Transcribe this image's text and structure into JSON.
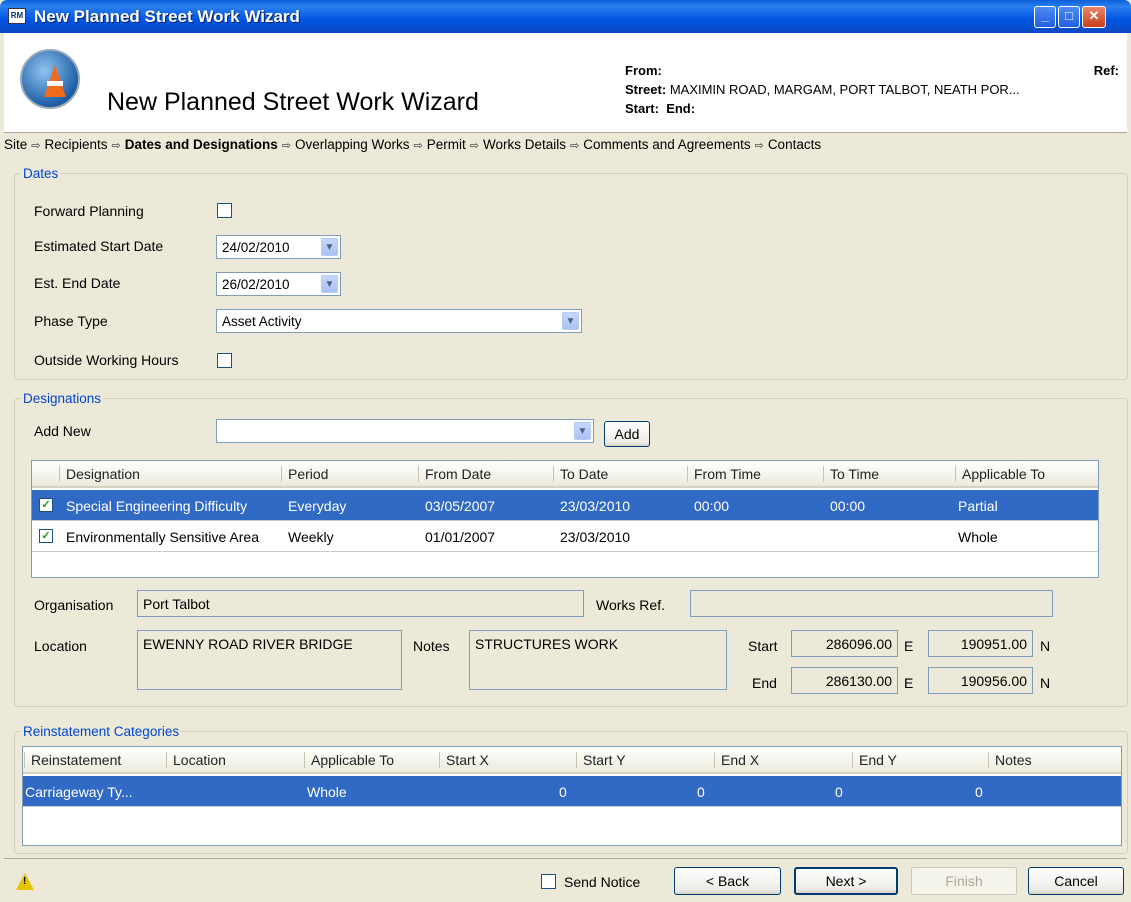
{
  "window": {
    "title": "New Planned Street Work Wizard",
    "app_icon_text": "RM"
  },
  "header": {
    "title": "New Planned Street Work Wizard",
    "from_label": "From:",
    "ref_label": "Ref:",
    "street_label": "Street:",
    "street_value": "MAXIMIN ROAD, MARGAM, PORT TALBOT, NEATH POR...",
    "start_label": "Start:",
    "end_label": "End:"
  },
  "steps": [
    {
      "label": "Site"
    },
    {
      "label": "Recipients"
    },
    {
      "label": "Dates and Designations",
      "active": true
    },
    {
      "label": "Overlapping Works"
    },
    {
      "label": "Permit"
    },
    {
      "label": "Works Details"
    },
    {
      "label": "Comments and Agreements"
    },
    {
      "label": "Contacts"
    }
  ],
  "dates": {
    "legend": "Dates",
    "forward_planning_label": "Forward Planning",
    "forward_planning_checked": false,
    "est_start_label": "Estimated Start Date",
    "est_start_value": "24/02/2010",
    "est_end_label": "Est. End Date",
    "est_end_value": "26/02/2010",
    "phase_type_label": "Phase Type",
    "phase_type_value": "Asset Activity",
    "outside_hours_label": "Outside Working Hours",
    "outside_hours_checked": false
  },
  "designations": {
    "legend": "Designations",
    "add_new_label": "Add New",
    "add_new_value": "",
    "add_button": "Add",
    "columns": [
      "Designation",
      "Period",
      "From Date",
      "To Date",
      "From Time",
      "To Time",
      "Applicable To"
    ],
    "rows": [
      {
        "checked": true,
        "selected": true,
        "cells": [
          "Special Engineering Difficulty",
          "Everyday",
          "03/05/2007",
          "23/03/2010",
          "00:00",
          "00:00",
          "Partial"
        ]
      },
      {
        "checked": true,
        "selected": false,
        "cells": [
          "Environmentally Sensitive Area",
          "Weekly",
          "01/01/2007",
          "23/03/2010",
          "",
          "",
          "Whole"
        ]
      }
    ],
    "organisation_label": "Organisation",
    "organisation_value": "Port Talbot",
    "works_ref_label": "Works Ref.",
    "works_ref_value": "",
    "location_label": "Location",
    "location_value": "EWENNY ROAD RIVER BRIDGE",
    "notes_label": "Notes",
    "notes_value": "STRUCTURES WORK",
    "start_label": "Start",
    "start_e": "286096.00",
    "start_n": "190951.00",
    "end_label": "End",
    "end_e": "286130.00",
    "end_n": "190956.00",
    "e_unit": "E",
    "n_unit": "N"
  },
  "reinstatement": {
    "legend": "Reinstatement Categories",
    "columns": [
      "Reinstatement",
      "Location",
      "Applicable To",
      "Start X",
      "Start Y",
      "End X",
      "End Y",
      "Notes"
    ],
    "rows": [
      {
        "selected": true,
        "cells": [
          "Carriageway Ty...",
          "",
          "Whole",
          "",
          "0",
          "0",
          "0",
          "0"
        ]
      }
    ]
  },
  "footer": {
    "send_notice_label": "Send Notice",
    "send_notice_checked": false,
    "back": "< Back",
    "next": "Next >",
    "finish": "Finish",
    "cancel": "Cancel"
  }
}
